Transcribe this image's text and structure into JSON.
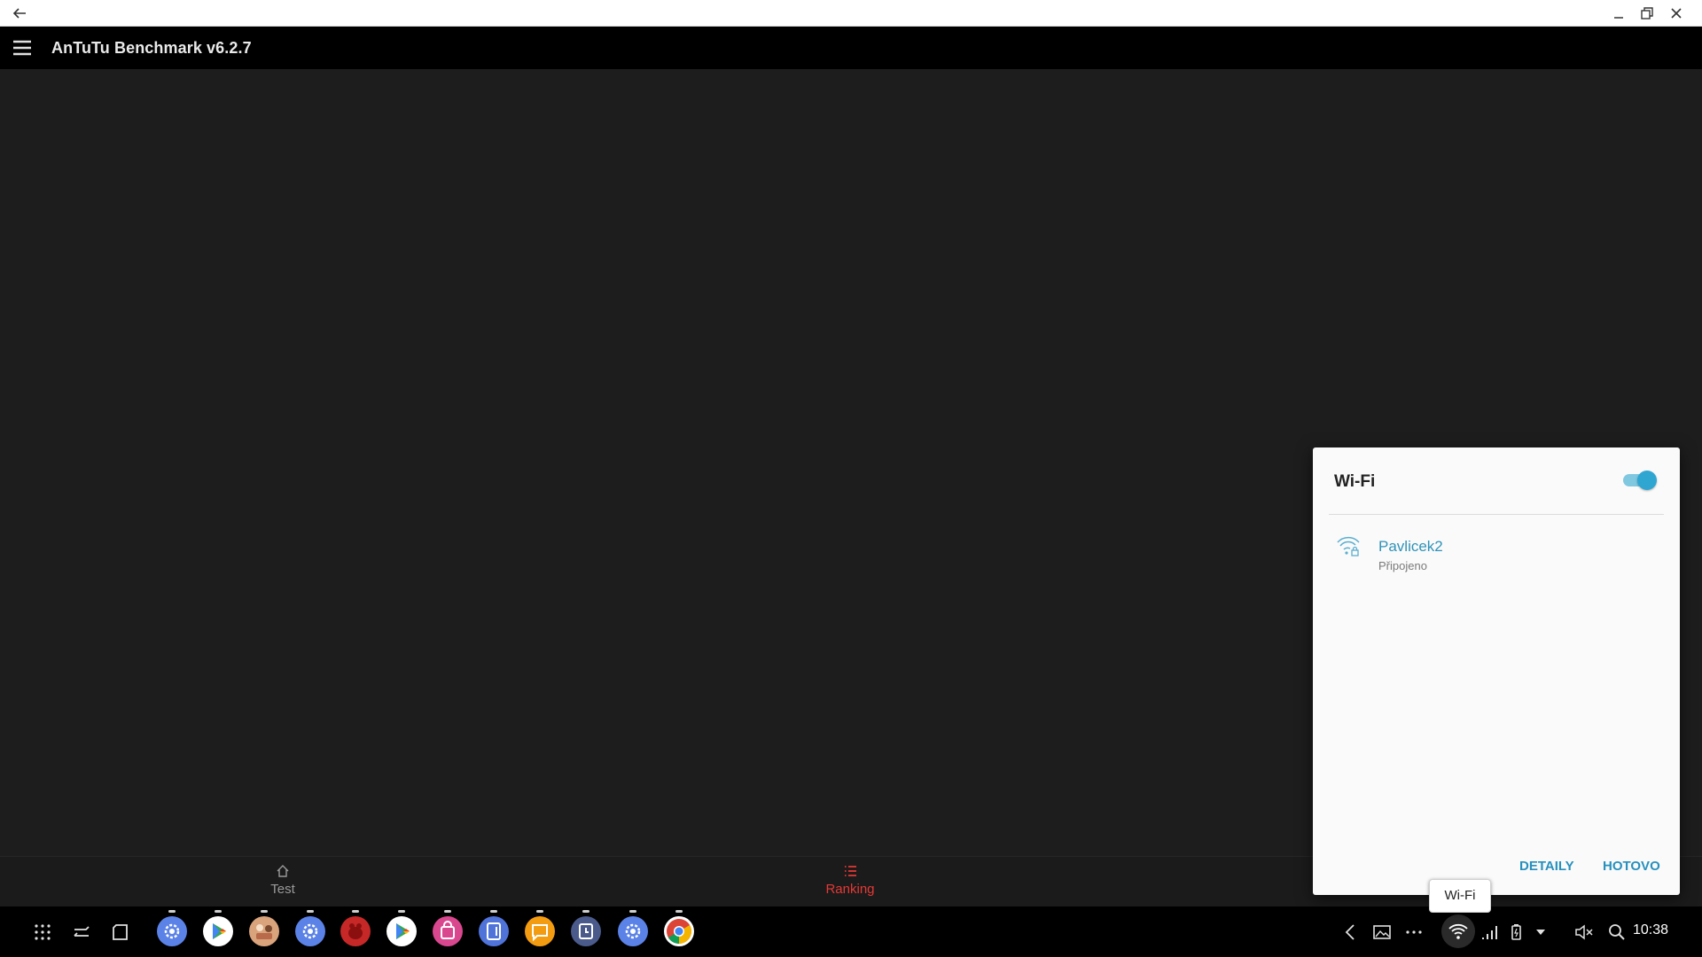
{
  "app": {
    "title": "AnTuTu Benchmark v6.2.7"
  },
  "window": {
    "controls": [
      "minimize-icon",
      "restore-icon",
      "close-icon"
    ]
  },
  "bottom_nav": {
    "items": [
      {
        "label": "Test",
        "icon": "home-icon",
        "active": false
      },
      {
        "label": "Ranking",
        "icon": "list-icon",
        "active": true
      }
    ],
    "active_color": "#e53935",
    "inactive_color": "#9a9a9a"
  },
  "wifi_dialog": {
    "title": "Wi-Fi",
    "toggle_on": true,
    "networks": [
      {
        "name": "Pavlicek2",
        "status": "Připojeno",
        "secured": true
      }
    ],
    "buttons": {
      "details": "DETAILY",
      "done": "HOTOVO"
    },
    "accent": "#2790bd"
  },
  "tooltip": {
    "text": "Wi-Fi"
  },
  "taskbar": {
    "left_icons": [
      "apps-grid-icon",
      "recent-apps-icon",
      "multi-window-icon"
    ],
    "pinned_apps": [
      "settings-icon",
      "play-store-icon",
      "gallery-app-icon",
      "settings-icon",
      "antutu-icon",
      "play-store-icon",
      "galaxy-store-icon",
      "notes-icon",
      "messages-icon",
      "clock-app-icon",
      "settings-icon",
      "chrome-icon"
    ],
    "tray_icons": [
      "chevron-left-icon",
      "image-icon",
      "more-icon",
      "wifi-icon",
      "signal-icon",
      "battery-icon",
      "dropdown-icon",
      "mute-icon",
      "search-icon"
    ],
    "time": "10:38"
  }
}
